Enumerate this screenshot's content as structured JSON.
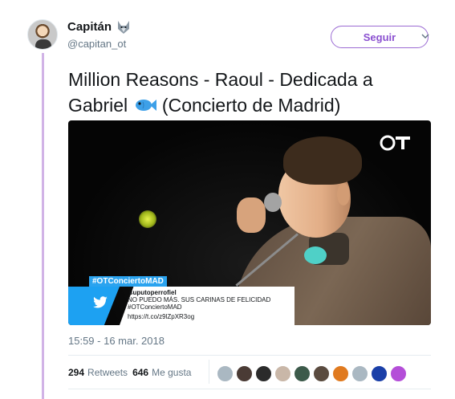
{
  "author": {
    "display_name": "Capitán",
    "handle": "@capitan_ot",
    "badge_icon": "wolf-icon"
  },
  "follow_button": {
    "label": "Seguir"
  },
  "menu": {
    "icon": "chevron-down-icon"
  },
  "tweet": {
    "text_before": "Million Reasons - Raoul - Dedicada a Gabriel ",
    "emoji_icon": "fish-icon",
    "text_after": " (Concierto de Madrid)"
  },
  "media": {
    "overlay": {
      "hashtag": "#OTConciertoMAD",
      "username": "suputoperrofiel",
      "text": "NO PUEDO MÁS. SUS CARINAS DE FELICIDAD #OTConciertoMAD",
      "link": "https://t.co/z9lZpXR3og"
    }
  },
  "timestamp": "15:59 - 16 mar. 2018",
  "stats": {
    "retweets_count": "294",
    "retweets_label": "Retweets",
    "likes_count": "646",
    "likes_label": "Me gusta"
  },
  "likers": [
    {
      "name": "liker-avatar-1",
      "color": "#aab8c2"
    },
    {
      "name": "liker-avatar-2",
      "color": "#4a3b35"
    },
    {
      "name": "liker-avatar-3",
      "color": "#2b2b2b"
    },
    {
      "name": "liker-avatar-4",
      "color": "#c9b7a8"
    },
    {
      "name": "liker-avatar-5",
      "color": "#3c5a4a"
    },
    {
      "name": "liker-avatar-6",
      "color": "#5a4b3f"
    },
    {
      "name": "liker-avatar-7",
      "color": "#e07a1f"
    },
    {
      "name": "liker-avatar-8",
      "color": "#aab8c2"
    },
    {
      "name": "liker-avatar-9",
      "color": "#1a3fa8"
    },
    {
      "name": "liker-avatar-10",
      "color": "#b44ed8"
    }
  ],
  "colors": {
    "accent": "#8a4fd0",
    "thread_line": "#d1b3e6",
    "twitter_blue": "#1da1f2"
  }
}
